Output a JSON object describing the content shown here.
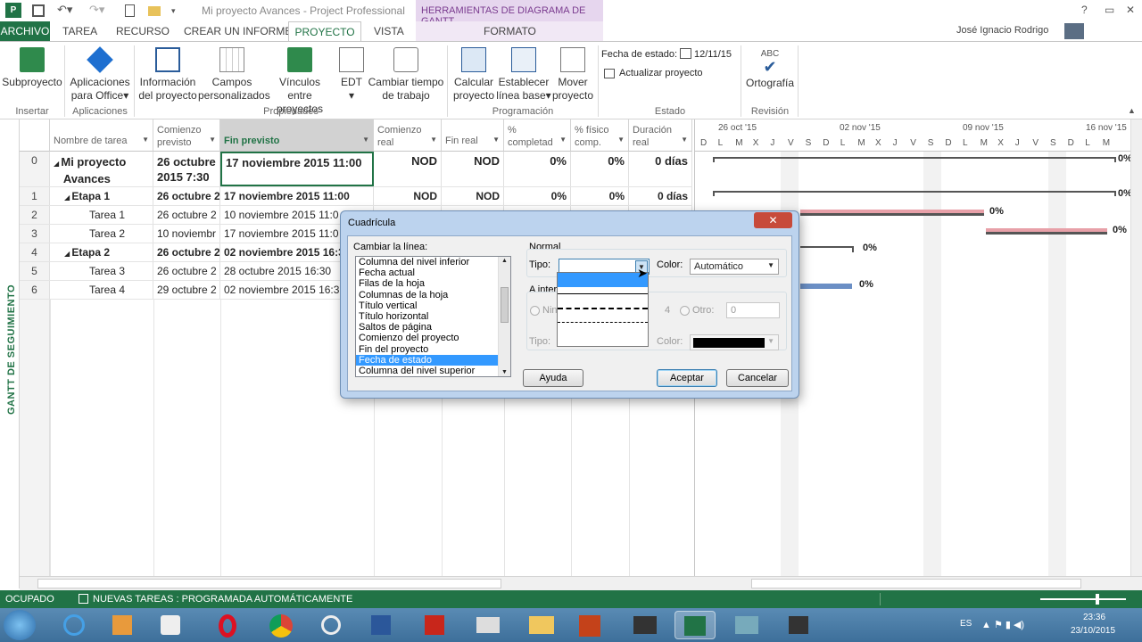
{
  "titlebar": {
    "title": "Mi proyecto Avances - Project Professional",
    "context_header": "HERRAMIENTAS DE DIAGRAMA DE GANTT",
    "user": "José Ignacio Rodrigo"
  },
  "tabs": {
    "archivo": "ARCHIVO",
    "tarea": "TAREA",
    "recurso": "RECURSO",
    "informe": "CREAR UN INFORME",
    "proyecto": "PROYECTO",
    "vista": "VISTA",
    "formato": "FORMATO"
  },
  "ribbon": {
    "subproyecto": "Subproyecto",
    "aplicaciones": [
      "Aplicaciones",
      "para Office"
    ],
    "info": [
      "Información",
      "del proyecto"
    ],
    "campos": [
      "Campos",
      "personalizados"
    ],
    "vinculos": [
      "Vínculos entre",
      "proyectos"
    ],
    "edt": "EDT",
    "cambiar": [
      "Cambiar tiempo",
      "de trabajo"
    ],
    "calcular": [
      "Calcular",
      "proyecto"
    ],
    "establecer": [
      "Establecer",
      "línea base"
    ],
    "mover": [
      "Mover",
      "proyecto"
    ],
    "fecha_estado_label": "Fecha de estado:",
    "fecha_estado_value": "12/11/15",
    "actualizar": "Actualizar proyecto",
    "abc": "ABC",
    "ortografia": "Ortografía",
    "groups": {
      "insertar": "Insertar",
      "aplicaciones": "Aplicaciones",
      "propiedades": "Propiedades",
      "programacion": "Programación",
      "estado": "Estado",
      "revision": "Revisión"
    }
  },
  "sidebar_label": "GANTT DE SEGUIMIENTO",
  "columns": {
    "nombre": "Nombre de tarea",
    "comienzo_prev": [
      "Comienzo",
      "previsto"
    ],
    "fin_prev": "Fin previsto",
    "comienzo_real": [
      "Comienzo",
      "real"
    ],
    "fin_real": "Fin real",
    "pct_comp": [
      "%",
      "completad"
    ],
    "pct_fis": [
      "% físico",
      "comp."
    ],
    "duracion": [
      "Duración",
      "real"
    ]
  },
  "rows": [
    {
      "id": "0",
      "name": [
        "Mi proyecto",
        "Avances"
      ],
      "start": [
        "26 octubre",
        "2015 7:30"
      ],
      "finish": "17 noviembre 2015 11:00",
      "start_real": "NOD",
      "finish_real": "NOD",
      "pct": "0%",
      "pct_fis": "0%",
      "dur": "0 días"
    },
    {
      "id": "1",
      "name": "Etapa 1",
      "start": "26 octubre 2",
      "finish": "17 noviembre 2015 11:00",
      "start_real": "NOD",
      "finish_real": "NOD",
      "pct": "0%",
      "pct_fis": "0%",
      "dur": "0 días"
    },
    {
      "id": "2",
      "name": "Tarea 1",
      "start": "26 octubre 2",
      "finish": "10 noviembre 2015 11:0"
    },
    {
      "id": "3",
      "name": "Tarea 2",
      "start": "10 noviembr",
      "finish": "17 noviembre 2015 11:0"
    },
    {
      "id": "4",
      "name": "Etapa 2",
      "start": "26 octubre 2",
      "finish": "02 noviembre 2015 16:3"
    },
    {
      "id": "5",
      "name": "Tarea 3",
      "start": "26 octubre 2",
      "finish": "28 octubre 2015 16:30"
    },
    {
      "id": "6",
      "name": "Tarea 4",
      "start": "29 octubre 2",
      "finish": "02 noviembre 2015 16:3"
    }
  ],
  "gantt": {
    "weeks": [
      "26 oct '15",
      "02 nov '15",
      "09 nov '15",
      "16 nov '15"
    ],
    "days": [
      "D",
      "L",
      "M",
      "X",
      "J",
      "V",
      "S",
      "D",
      "L",
      "M",
      "X",
      "J",
      "V",
      "S",
      "D",
      "L",
      "M",
      "X",
      "J",
      "V",
      "S",
      "D",
      "L",
      "M"
    ],
    "labels": [
      "0%",
      "0%",
      "0%",
      "0%",
      "0%",
      "0%"
    ]
  },
  "dialog": {
    "title": "Cuadrícula",
    "cambiar_label": "Cambiar la línea:",
    "items": [
      "Columna del nivel inferior",
      "Fecha actual",
      "Filas de la hoja",
      "Columnas de la hoja",
      "Título vertical",
      "Título horizontal",
      "Saltos de página",
      "Comienzo del proyecto",
      "Fin del proyecto",
      "Fecha de estado",
      "Columna del nivel superior"
    ],
    "selected_item": "Fecha de estado",
    "normal": "Normal",
    "tipo": "Tipo:",
    "color": "Color:",
    "color_value": "Automático",
    "a_intervalos": "A inter",
    "ninguno": "Nin",
    "four": "4",
    "otro": "Otro:",
    "otro_value": "0",
    "tipo2": "Tipo:",
    "color2": "Color:",
    "ayuda": "Ayuda",
    "aceptar": "Aceptar",
    "cancelar": "Cancelar"
  },
  "status": {
    "ocupado": "OCUPADO",
    "nuevas": "NUEVAS TAREAS : PROGRAMADA AUTOMÁTICAMENTE"
  },
  "taskbar": {
    "lang": "ES",
    "time": "23:36",
    "date": "23/10/2015"
  }
}
